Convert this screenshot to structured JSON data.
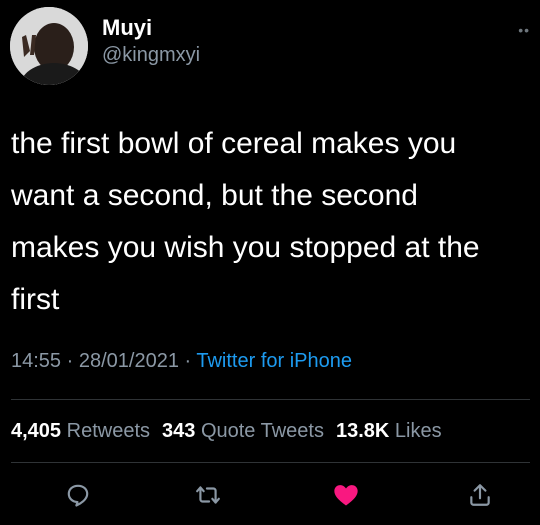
{
  "user": {
    "display_name": "Muyi",
    "handle": "@kingmxyi"
  },
  "tweet": {
    "text_lines": [
      "the first bowl of cereal makes you",
      "want a second, but the second",
      "makes you wish you stopped at the",
      "first"
    ]
  },
  "meta": {
    "time": "14:55",
    "separator1": " · ",
    "date": "28/01/2021",
    "separator2": " · ",
    "source": "Twitter for iPhone"
  },
  "stats": {
    "retweets_count": "4,405",
    "retweets_label": "Retweets",
    "quotes_count": "343",
    "quotes_label": "Quote Tweets",
    "likes_count": "13.8K",
    "likes_label": "Likes"
  },
  "actions": {
    "reply_icon": "reply-icon",
    "retweet_icon": "retweet-icon",
    "like_icon": "heart-icon",
    "share_icon": "share-icon"
  },
  "colors": {
    "background": "#000000",
    "text": "#ffffff",
    "secondary": "#8b98a5",
    "link": "#1d9bf0",
    "like": "#f91880"
  }
}
